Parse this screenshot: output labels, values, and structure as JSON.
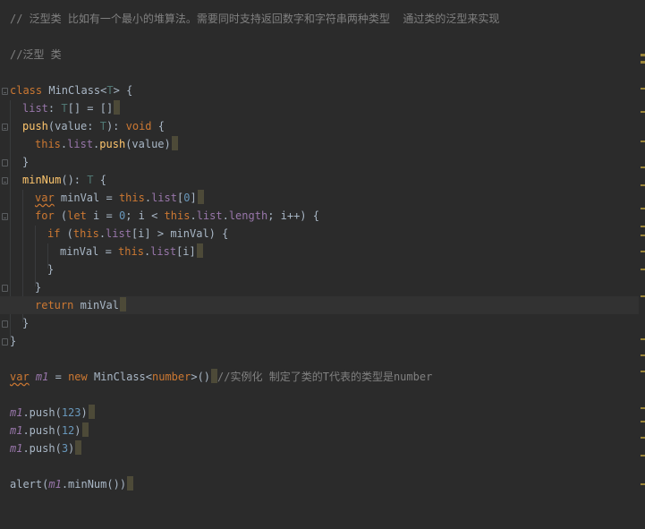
{
  "editor": {
    "comment_line1": "// 泛型类 比如有一个最小的堆算法。需要同时支持返回数字和字符串两种类型  通过类的泛型来实现",
    "comment_line2": "//泛型 类",
    "class_kw": "class",
    "class_name": "MinClass",
    "type_param_open": "<",
    "type_param": "T",
    "type_param_close": ">",
    "brace_open": " {",
    "brace_close": "}",
    "list_prop": "list",
    "list_colon": ": ",
    "list_type_T": "T",
    "list_type_rest": "[] = []",
    "push_name": "push",
    "push_params_open": "(value: ",
    "push_param_type": "T",
    "push_params_close": "): ",
    "void_kw": "void",
    "this_kw": "this",
    "dot": ".",
    "push_call": "push",
    "push_call_args": "(value)",
    "minnum_name": "minNum",
    "minnum_sig": "(): ",
    "minnum_return_type": "T",
    "var_kw": "var",
    "minval_decl": " minVal = ",
    "index_zero_open": "[",
    "index_zero": "0",
    "index_zero_close": "]",
    "for_kw": "for",
    "for_open": " (",
    "let_kw": "let",
    "for_i_eq": " i = ",
    "for_zero": "0",
    "for_mid": "; i < ",
    "length_prop": "length",
    "for_end": "; i++) {",
    "if_kw": "if",
    "if_open": " (",
    "index_i": "[i]",
    "if_cmp": " > minVal) {",
    "minval_assign": "minVal = ",
    "return_kw": "return",
    "return_val": " minVal",
    "m1_var": "m1",
    "new_kw": "new",
    "inst_space": " = ",
    "inst_class": " MinClass<",
    "inst_type": "number",
    "inst_close": ">()",
    "inst_comment": "//实例化 制定了类的T代表的类型是number",
    "push_123_open": ".push(",
    "push_123": "123",
    "push_12": "12",
    "push_3": "3",
    "paren_close": ")",
    "alert_call": "alert(",
    "minnum_call": ".minNum()",
    "alert_close": ")"
  },
  "colors": {
    "background": "#2b2b2b",
    "keyword": "#cc7832",
    "function": "#ffc66d",
    "number": "#6897bb",
    "comment": "#808080",
    "type_param": "#507874",
    "property": "#9876aa",
    "text": "#a9b7c6",
    "scroll_marker": "#9a8438"
  }
}
